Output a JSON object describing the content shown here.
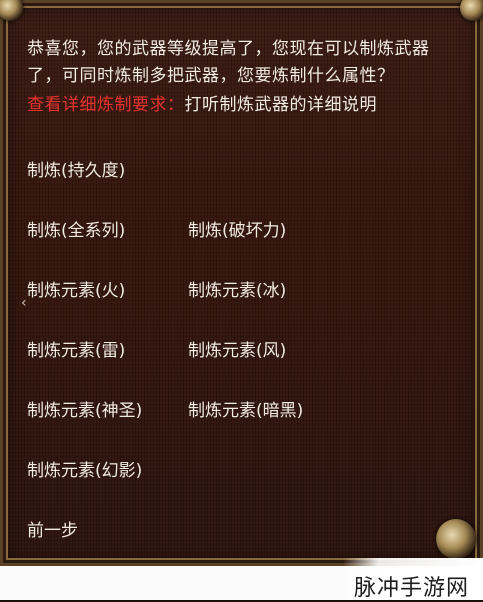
{
  "dialog": {
    "intro_line1": "恭喜您，您的武器等级提高了，您现在可以制炼武器",
    "intro_line2": "了，可同时炼制多把武器，您要炼制什么属性？",
    "detail_prefix": "查看详细炼制要求：",
    "detail_link": "打听制炼武器的详细说明"
  },
  "options": [
    {
      "label": "制炼(持久度)"
    },
    {
      "label": "制炼(全系列)"
    },
    {
      "label": "制炼(破坏力)"
    },
    {
      "label": "制炼元素(火)"
    },
    {
      "label": "制炼元素(冰)"
    },
    {
      "label": "制炼元素(雷)"
    },
    {
      "label": "制炼元素(风)"
    },
    {
      "label": "制炼元素(神圣)"
    },
    {
      "label": "制炼元素(暗黑)"
    },
    {
      "label": "制炼元素(幻影)"
    }
  ],
  "back_label": "前一步",
  "watermark": "脉冲手游网",
  "colors": {
    "highlight_red": "#e8322d",
    "text": "#f1ece2",
    "panel_bg": "#35170f"
  }
}
